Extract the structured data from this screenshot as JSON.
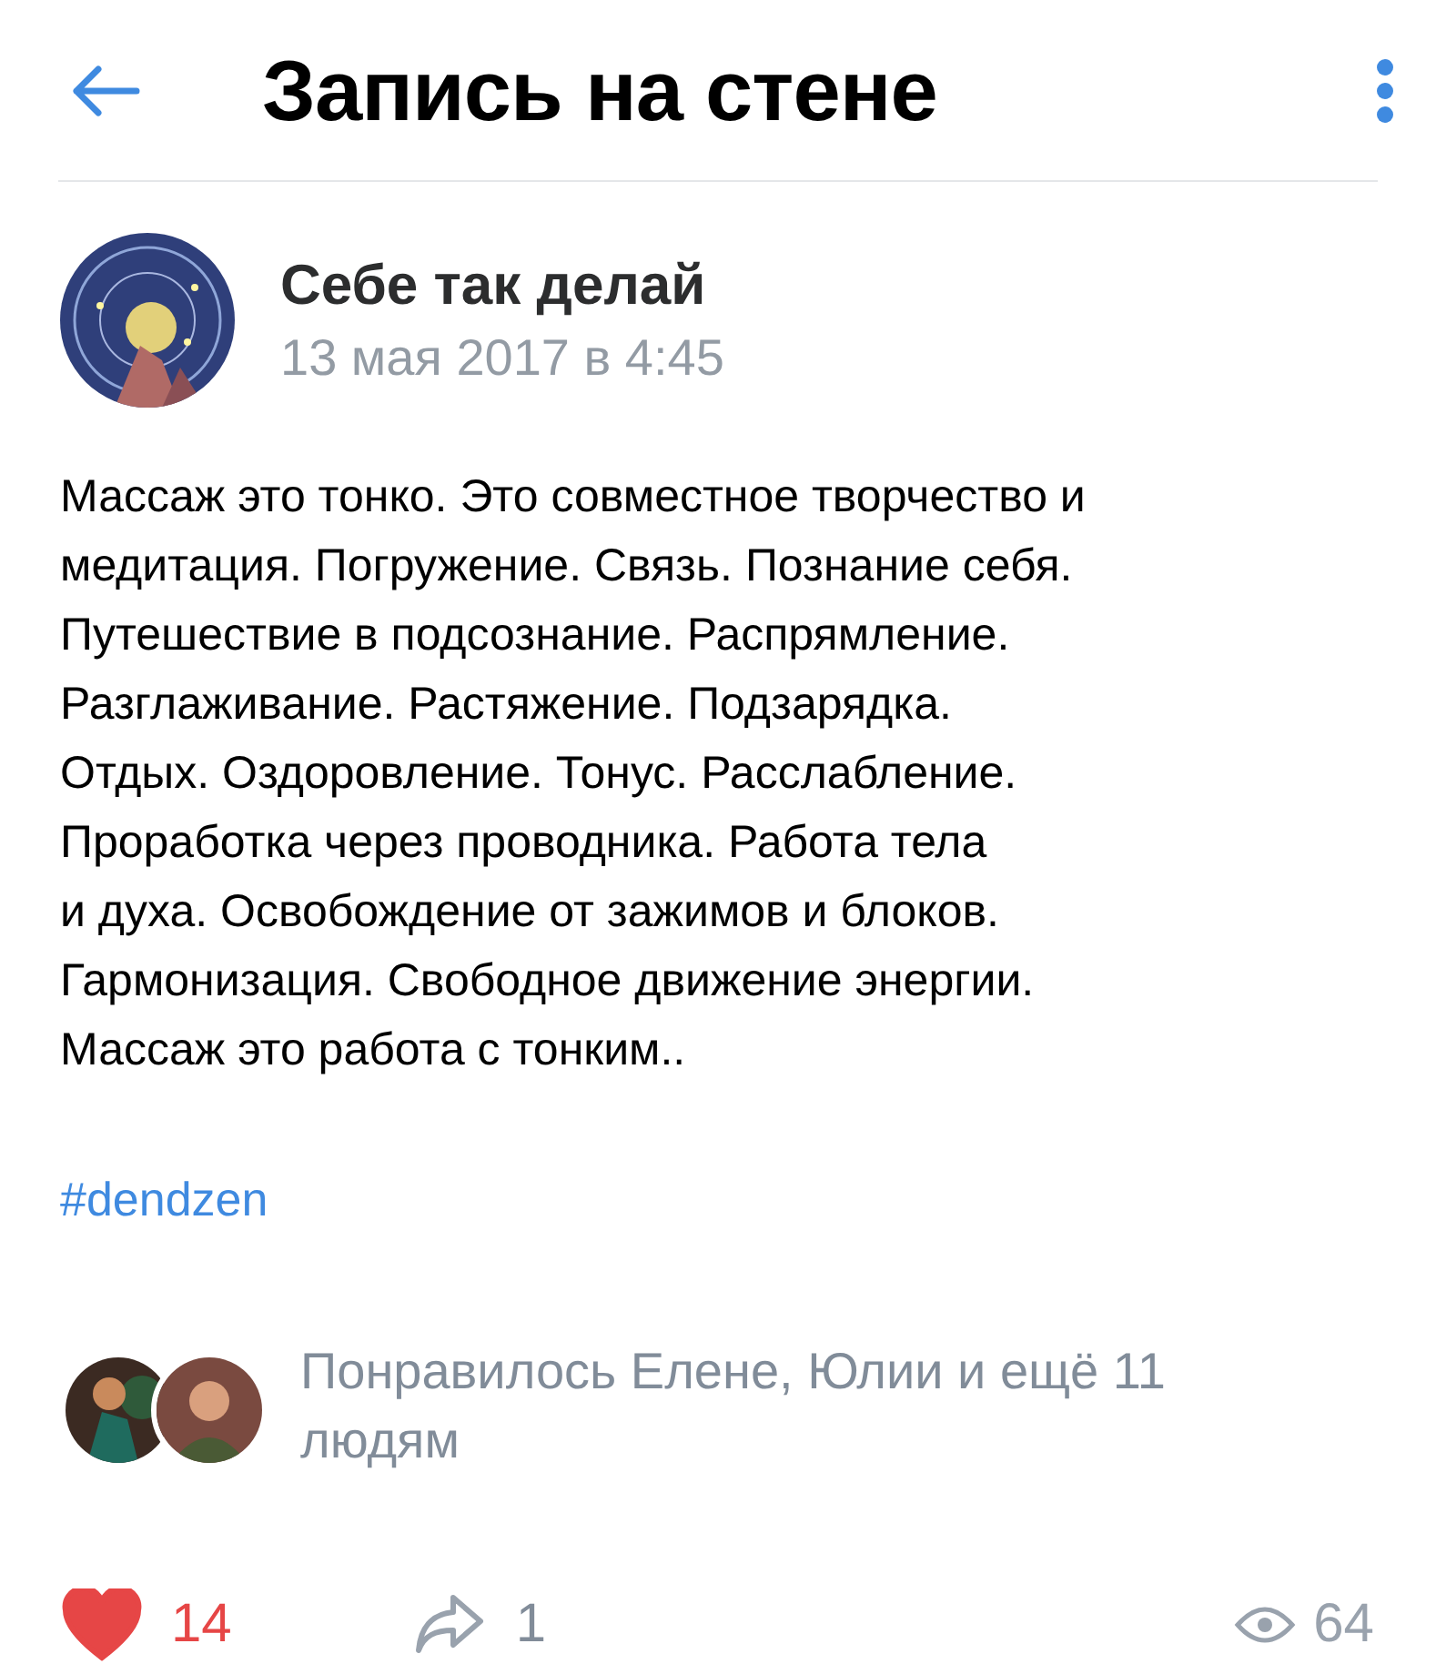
{
  "header": {
    "title": "Запись на стене"
  },
  "post": {
    "author": "Себе так делай",
    "date": "13 мая 2017 в 4:45",
    "text": "Массаж это тонко. Это совместное творчество и\nмедитация. Погружение. Связь. Познание себя.\nПутешествие в подсознание. Распрямление.\nРазглаживание. Растяжение. Подзарядка.\nОтдых. Оздоровление. Тонус. Расслабление.\nПроработка через проводника. Работа тела\nи духа. Освобождение от зажимов и блоков.\nГармонизация. Свободное движение энергии.\nМассаж это работа с тонким..",
    "hashtag": "#dendzen"
  },
  "likes": {
    "text": "Понравилось Елене, Юлии и ещё 11\nлюдям"
  },
  "actions": [
    {
      "kind": "like",
      "count": "14",
      "selected": true
    },
    {
      "kind": "share",
      "count": "1",
      "selected": false
    },
    {
      "kind": "views",
      "count": "64"
    }
  ]
}
